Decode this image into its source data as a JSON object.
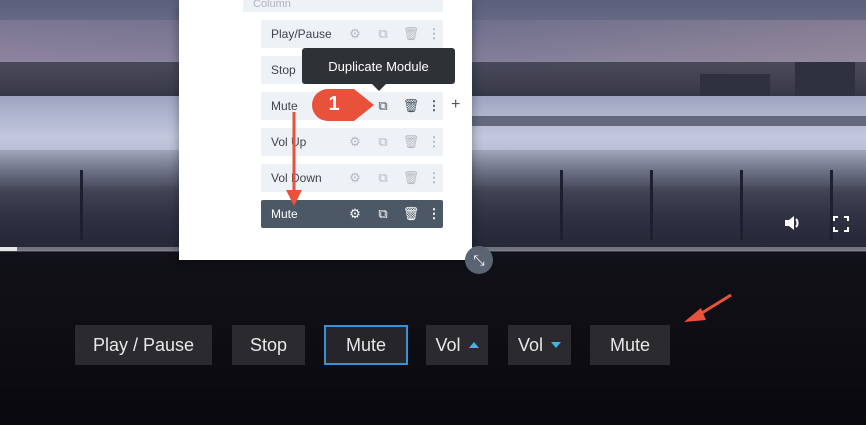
{
  "builder": {
    "column_label": "Column",
    "modules": [
      {
        "label": "Play/Pause"
      },
      {
        "label": "Stop"
      },
      {
        "label": "Mute"
      },
      {
        "label": "Vol Up"
      },
      {
        "label": "Vol Down"
      },
      {
        "label": "Mute"
      }
    ],
    "module_icons": [
      "gear-icon",
      "duplicate-icon",
      "trash-icon",
      "more-icon"
    ],
    "tooltip": "Duplicate Module",
    "callout_number": "1",
    "add_label": "+"
  },
  "video": {
    "progress_fraction": 0.02,
    "icons": [
      "volume-icon",
      "fullscreen-icon"
    ]
  },
  "controls": {
    "play_pause": "Play / Pause",
    "stop": "Stop",
    "mute": "Mute",
    "vol_up": "Vol",
    "vol_down": "Vol",
    "mute_copy": "Mute"
  },
  "colors": {
    "accent": "#3a8fd9",
    "caret": "#3fb4e8",
    "annotation": "#e8513a",
    "selected_module": "#4c5866"
  }
}
